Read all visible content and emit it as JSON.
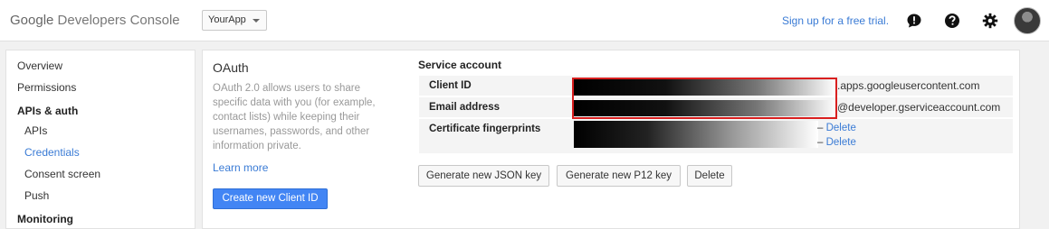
{
  "header": {
    "logo_google": "Google",
    "logo_product": "Developers Console",
    "project_selector": "YourApp",
    "signup_link": "Sign up for a free trial.",
    "icons": [
      "feedback-icon",
      "help-icon",
      "gear-icon"
    ]
  },
  "sidebar": {
    "items": [
      {
        "label": "Overview"
      },
      {
        "label": "Permissions"
      },
      {
        "label": "APIs & auth"
      },
      {
        "label": "APIs"
      },
      {
        "label": "Credentials"
      },
      {
        "label": "Consent screen"
      },
      {
        "label": "Push"
      },
      {
        "label": "Monitoring"
      }
    ],
    "active_item": "Credentials"
  },
  "oauth": {
    "title": "OAuth",
    "description": "OAuth 2.0 allows users to share specific data with you (for example, contact lists) while keeping their usernames, passwords, and other information private.",
    "learn_more": "Learn more",
    "create_button": "Create new Client ID"
  },
  "service_account": {
    "title": "Service account",
    "rows": [
      {
        "label": "Client ID",
        "suffix": ".apps.googleusercontent.com"
      },
      {
        "label": "Email address",
        "suffix": "@developer.gserviceaccount.com"
      },
      {
        "label": "Certificate fingerprints"
      }
    ],
    "fingerprint_links": [
      {
        "dash": "–",
        "link": "Delete"
      },
      {
        "dash": "–",
        "link": "Delete"
      }
    ],
    "buttons": [
      "Generate new JSON key",
      "Generate new P12 key",
      "Delete"
    ]
  },
  "colors": {
    "link": "#3a7bd5",
    "primary_button": "#4285f4",
    "highlight_border": "#d91f1f"
  }
}
